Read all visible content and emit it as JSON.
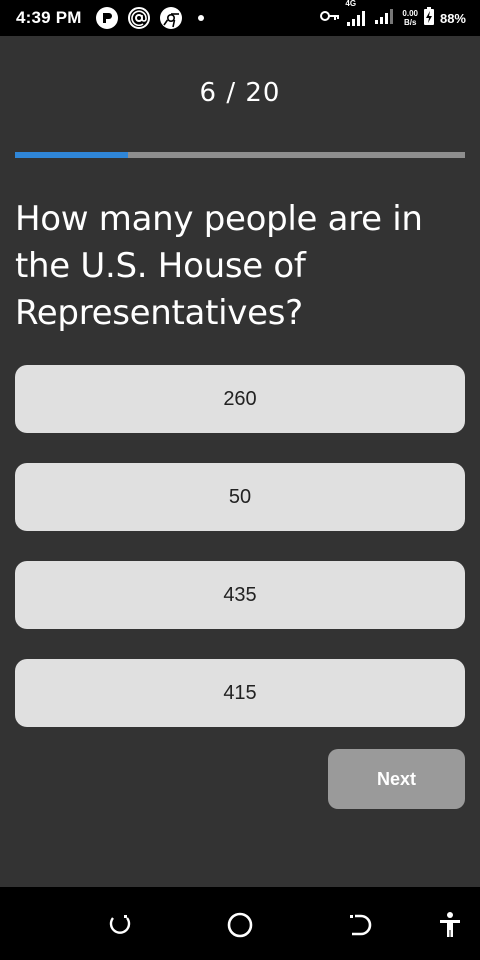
{
  "status_bar": {
    "time": "4:39 PM",
    "network_type": "4G",
    "data_speed_top": "0.00",
    "data_speed_bottom": "B/s",
    "battery_percent": "88%",
    "icons": [
      "app-r-icon",
      "at-sign-icon",
      "chrome-icon",
      "notification-dot-icon",
      "vpn-key-icon",
      "signal-icon",
      "signal-icon-2",
      "battery-charging-icon"
    ]
  },
  "quiz": {
    "progress_label": "6 / 20",
    "progress_fraction": 0.25,
    "question": "How many people are in the U.S. House of Representatives?",
    "answers": [
      "260",
      "50",
      "435",
      "415"
    ],
    "next_label": "Next"
  },
  "colors": {
    "background": "#333333",
    "progress_fill": "#2f86d8",
    "progress_track": "#8e8e8e",
    "answer_bg": "#e0e0e0",
    "next_bg": "#9a9a9a"
  },
  "nav_bar": {
    "icons": [
      "recent-apps-icon",
      "home-icon",
      "back-icon",
      "accessibility-icon"
    ]
  }
}
